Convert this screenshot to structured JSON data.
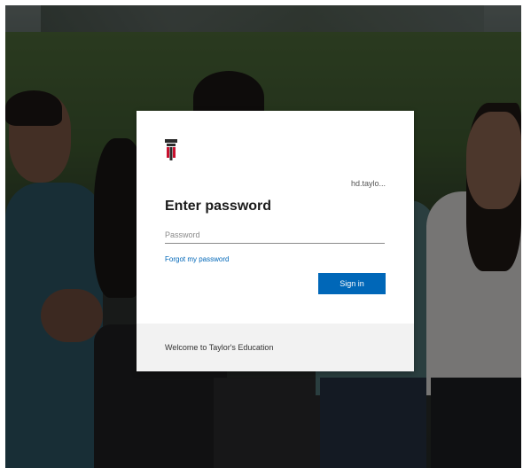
{
  "login": {
    "identity": "hd.taylo...",
    "title": "Enter password",
    "password_placeholder": "Password",
    "forgot_link": "Forgot my password",
    "signin_label": "Sign in",
    "footer_text": "Welcome to Taylor's Education"
  },
  "colors": {
    "accent": "#0067b8",
    "logo_red": "#c8102e",
    "logo_dark": "#2b2b2b"
  },
  "icons": {
    "logo": "taylors-logo-icon"
  }
}
